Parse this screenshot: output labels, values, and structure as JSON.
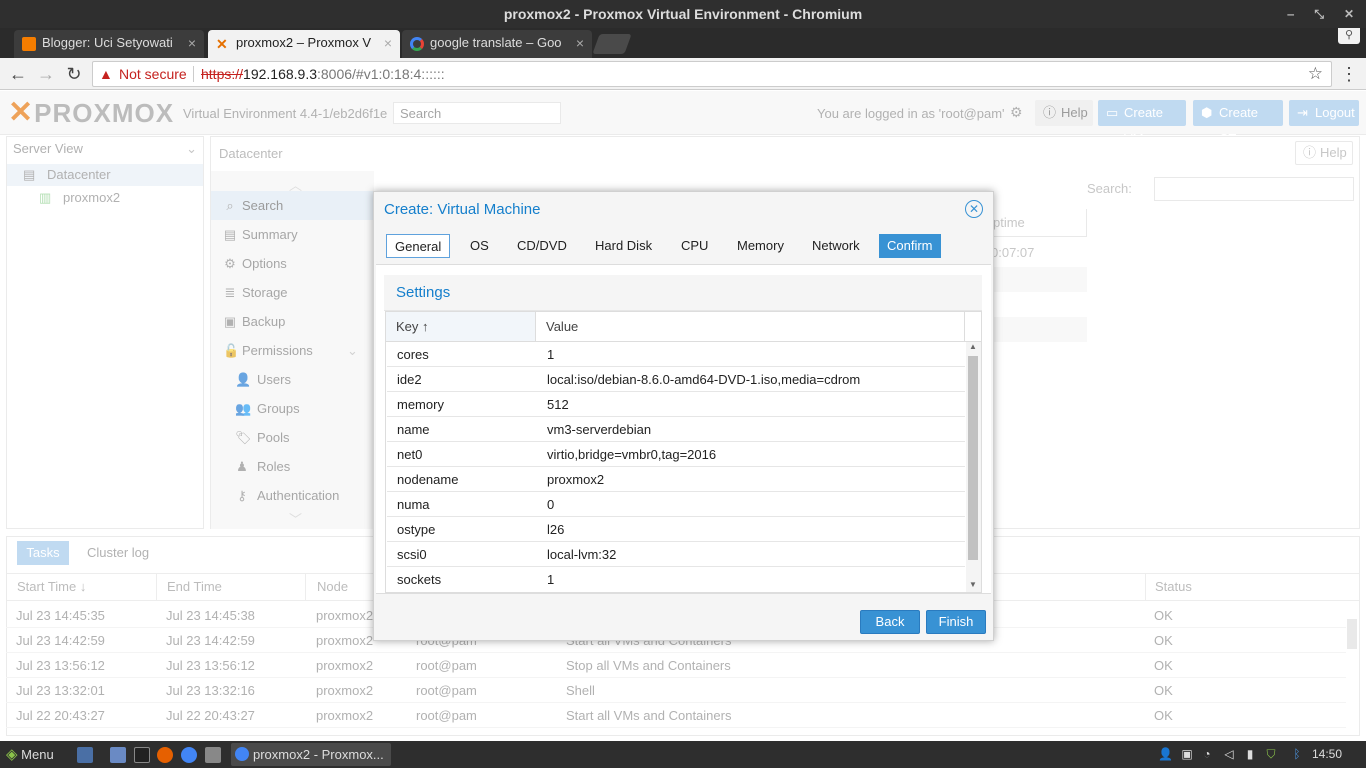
{
  "window": {
    "title": "proxmox2 - Proxmox Virtual Environment - Chromium"
  },
  "browser": {
    "tabs": [
      {
        "label": "Blogger: Uci Setyowati",
        "close": "×"
      },
      {
        "label": "proxmox2 – Proxmox V",
        "close": "×"
      },
      {
        "label": "google translate – Goo",
        "close": "×"
      }
    ],
    "security_label": "Not secure",
    "url_scheme": "https://",
    "url_host": "192.168.9.3",
    "url_rest": ":8006/#v1:0:18:4::::::",
    "star": "☆"
  },
  "pve": {
    "logo": "PROXMOX",
    "version": "Virtual Environment 4.4-1/eb2d6f1e",
    "search_placeholder": "Search",
    "logged_in": "You are logged in as 'root@pam'",
    "help": "Help",
    "create_vm": "Create VM",
    "create_ct": "Create CT",
    "logout": "Logout"
  },
  "tree": {
    "view": "Server View",
    "datacenter": "Datacenter",
    "node": "proxmox2"
  },
  "content": {
    "title": "Datacenter",
    "help": "Help",
    "search_label": "Search:",
    "uptime_header": "ptime",
    "uptime_value": "0:07:07"
  },
  "menu": [
    {
      "label": "Search",
      "icon": "⌕"
    },
    {
      "label": "Summary",
      "icon": "▤"
    },
    {
      "label": "Options",
      "icon": "⚙"
    },
    {
      "label": "Storage",
      "icon": "≣"
    },
    {
      "label": "Backup",
      "icon": "▣"
    },
    {
      "label": "Permissions",
      "icon": "🔓"
    },
    {
      "label": "Users",
      "icon": "👤"
    },
    {
      "label": "Groups",
      "icon": "👥"
    },
    {
      "label": "Pools",
      "icon": "🏷"
    },
    {
      "label": "Roles",
      "icon": "♟"
    },
    {
      "label": "Authentication",
      "icon": "⚷"
    }
  ],
  "tasks": {
    "tab_tasks": "Tasks",
    "tab_cluster": "Cluster log",
    "headers": {
      "start": "Start Time",
      "end": "End Time",
      "node": "Node",
      "status": "Status"
    },
    "rows": [
      {
        "start": "Jul 23 14:45:35",
        "end": "Jul 23 14:45:38",
        "node": "proxmox2",
        "user": "",
        "desc": "",
        "status": "OK"
      },
      {
        "start": "Jul 23 14:42:59",
        "end": "Jul 23 14:42:59",
        "node": "proxmox2",
        "user": "root@pam",
        "desc": "Start all VMs and Containers",
        "status": "OK"
      },
      {
        "start": "Jul 23 13:56:12",
        "end": "Jul 23 13:56:12",
        "node": "proxmox2",
        "user": "root@pam",
        "desc": "Stop all VMs and Containers",
        "status": "OK"
      },
      {
        "start": "Jul 23 13:32:01",
        "end": "Jul 23 13:32:16",
        "node": "proxmox2",
        "user": "root@pam",
        "desc": "Shell",
        "status": "OK"
      },
      {
        "start": "Jul 22 20:43:27",
        "end": "Jul 22 20:43:27",
        "node": "proxmox2",
        "user": "root@pam",
        "desc": "Start all VMs and Containers",
        "status": "OK"
      }
    ]
  },
  "dialog": {
    "title": "Create: Virtual Machine",
    "tabs": [
      "General",
      "OS",
      "CD/DVD",
      "Hard Disk",
      "CPU",
      "Memory",
      "Network",
      "Confirm"
    ],
    "section": "Settings",
    "col_key": "Key",
    "col_value": "Value",
    "settings": [
      {
        "key": "cores",
        "value": "1"
      },
      {
        "key": "ide2",
        "value": "local:iso/debian-8.6.0-amd64-DVD-1.iso,media=cdrom"
      },
      {
        "key": "memory",
        "value": "512"
      },
      {
        "key": "name",
        "value": "vm3-serverdebian"
      },
      {
        "key": "net0",
        "value": "virtio,bridge=vmbr0,tag=2016"
      },
      {
        "key": "nodename",
        "value": "proxmox2"
      },
      {
        "key": "numa",
        "value": "0"
      },
      {
        "key": "ostype",
        "value": "l26"
      },
      {
        "key": "scsi0",
        "value": "local-lvm:32"
      },
      {
        "key": "sockets",
        "value": "1"
      }
    ],
    "back": "Back",
    "finish": "Finish"
  },
  "taskbar": {
    "menu": "Menu",
    "window": "proxmox2 - Proxmox...",
    "clock": "14:50"
  },
  "colors": {
    "accent": "#3892d4",
    "brand_orange": "#e57000"
  }
}
